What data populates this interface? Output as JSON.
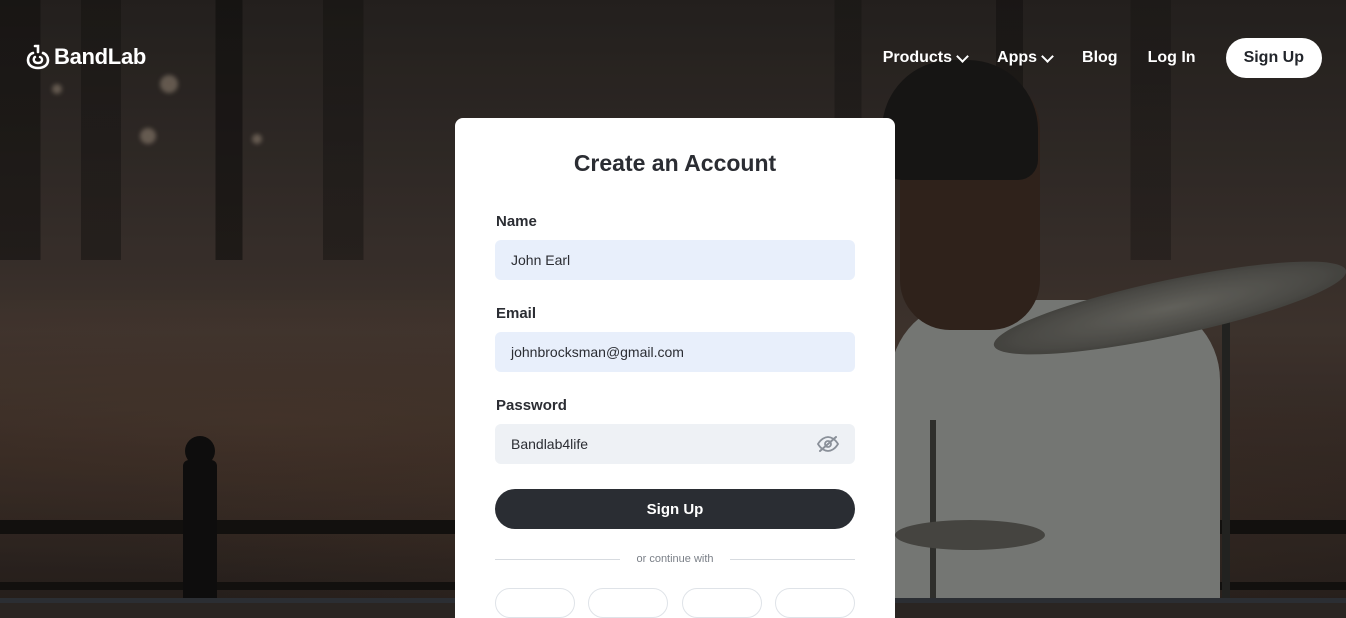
{
  "header": {
    "logo_text": "BandLab",
    "nav": [
      {
        "label": "Products",
        "has_dropdown": true
      },
      {
        "label": "Apps",
        "has_dropdown": true
      },
      {
        "label": "Blog",
        "has_dropdown": false
      },
      {
        "label": "Log In",
        "has_dropdown": false
      }
    ],
    "signup_label": "Sign Up"
  },
  "form": {
    "title": "Create an Account",
    "name_label": "Name",
    "name_value": "John Earl",
    "email_label": "Email",
    "email_value": "johnbrocksman@gmail.com",
    "password_label": "Password",
    "password_value": "Bandlab4life",
    "password_toggle_icon": "eye-slash-icon",
    "submit_label": "Sign Up",
    "divider_text": "or continue with"
  },
  "colors": {
    "button_dark": "#2a2d33",
    "autofill_bg": "#e8effb",
    "field_bg": "#eef1f5",
    "text": "#2b2d33"
  }
}
